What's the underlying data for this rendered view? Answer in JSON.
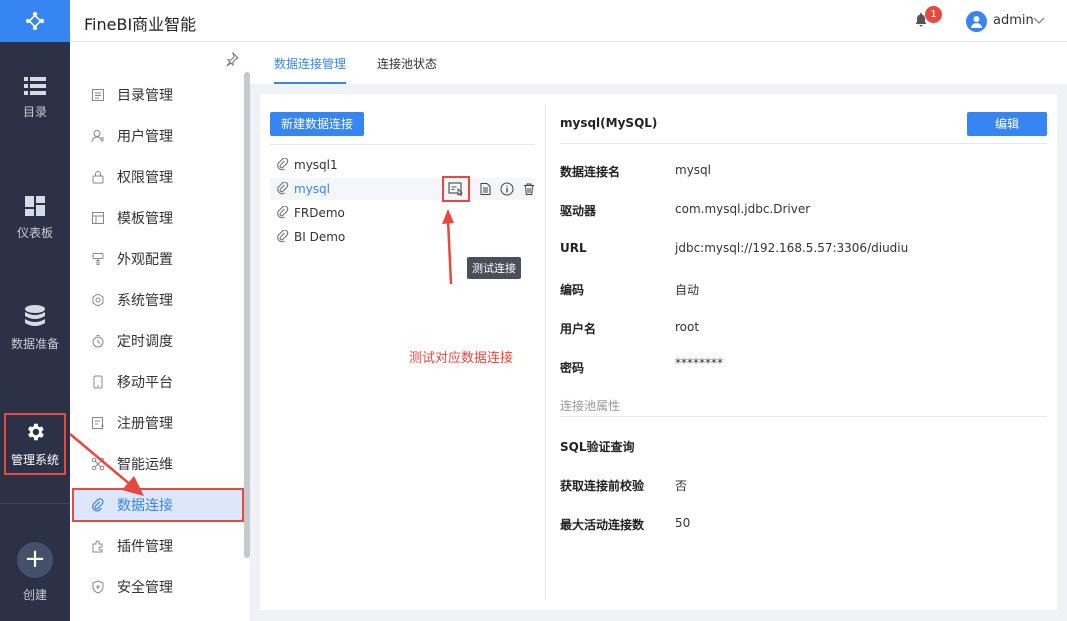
{
  "app": {
    "title": "FineBI商业智能"
  },
  "header": {
    "notification_count": "1",
    "username": "admin"
  },
  "rail": {
    "items": [
      {
        "label": "目录",
        "icon": "list-icon"
      },
      {
        "label": "仪表板",
        "icon": "dashboard-icon"
      },
      {
        "label": "数据准备",
        "icon": "database-icon"
      },
      {
        "label": "管理系统",
        "icon": "gear-icon"
      },
      {
        "label": "创建",
        "icon": "plus-icon"
      }
    ]
  },
  "menu": {
    "items": [
      {
        "label": "目录管理",
        "icon": "catalog-icon"
      },
      {
        "label": "用户管理",
        "icon": "user-icon"
      },
      {
        "label": "权限管理",
        "icon": "lock-icon"
      },
      {
        "label": "模板管理",
        "icon": "template-icon"
      },
      {
        "label": "外观配置",
        "icon": "brush-icon"
      },
      {
        "label": "系统管理",
        "icon": "settings-icon"
      },
      {
        "label": "定时调度",
        "icon": "timer-icon"
      },
      {
        "label": "移动平台",
        "icon": "mobile-icon"
      },
      {
        "label": "注册管理",
        "icon": "register-icon"
      },
      {
        "label": "智能运维",
        "icon": "ops-icon"
      },
      {
        "label": "数据连接",
        "icon": "link-icon"
      },
      {
        "label": "插件管理",
        "icon": "plugin-icon"
      },
      {
        "label": "安全管理",
        "icon": "shield-icon"
      }
    ],
    "active": "数据连接"
  },
  "tabs": [
    {
      "label": "数据连接管理"
    },
    {
      "label": "连接池状态"
    }
  ],
  "connections": {
    "new_button": "新建数据连接",
    "items": [
      "mysql1",
      "mysql",
      "FRDemo",
      "BI Demo"
    ],
    "selected": "mysql",
    "tooltip": "测试连接",
    "annotation": "测试对应数据连接"
  },
  "detail": {
    "title": "mysql(MySQL)",
    "edit_button": "编辑",
    "fields": [
      {
        "label": "数据连接名",
        "value": "mysql"
      },
      {
        "label": "驱动器",
        "value": "com.mysql.jdbc.Driver"
      },
      {
        "label": "URL",
        "value": "jdbc:mysql://192.168.5.57:3306/diudiu"
      },
      {
        "label": "编码",
        "value": "自动"
      },
      {
        "label": "用户名",
        "value": "root"
      },
      {
        "label": "密码",
        "value": "********"
      }
    ],
    "pool_section": "连接池属性",
    "pool_fields": [
      {
        "label": "SQL验证查询",
        "value": ""
      },
      {
        "label": "获取连接前校验",
        "value": "否"
      },
      {
        "label": "最大活动连接数",
        "value": "50"
      }
    ]
  },
  "colors": {
    "accent": "#3685f2",
    "rail": "#2b3247",
    "annotation": "#e8483d"
  }
}
